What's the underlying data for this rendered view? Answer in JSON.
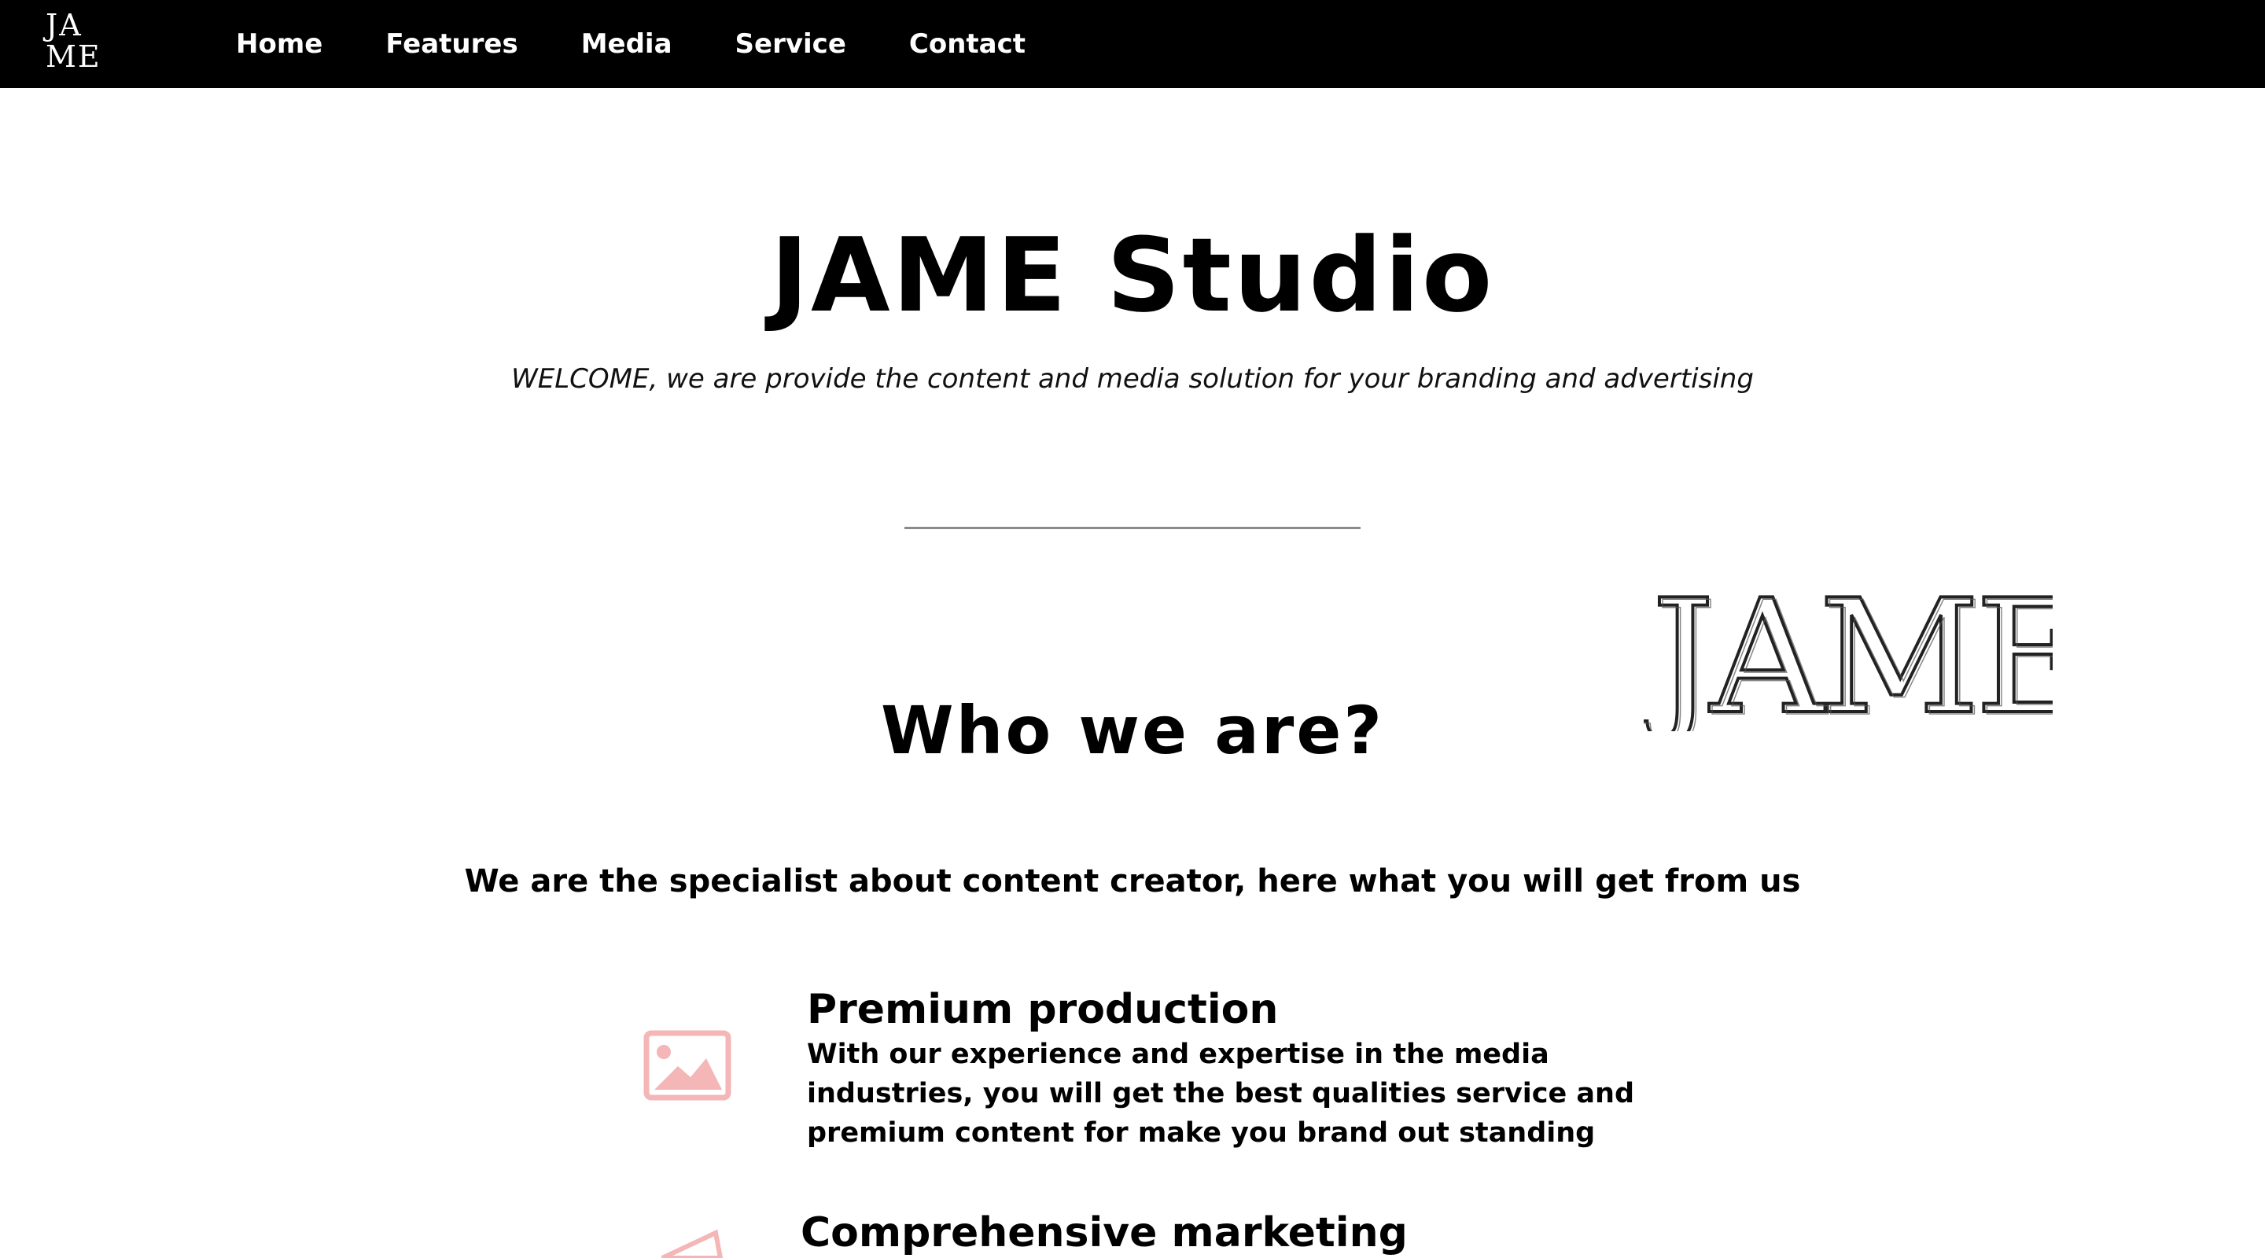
{
  "nav": {
    "logo_line1": "JA",
    "logo_line2": "ME",
    "links": [
      {
        "label": "Home"
      },
      {
        "label": "Features"
      },
      {
        "label": "Media"
      },
      {
        "label": "Service"
      },
      {
        "label": "Contact"
      }
    ]
  },
  "hero": {
    "title": "JAME Studio",
    "subtitle": "WELCOME, we are provide the content and media solution for your branding and advertising"
  },
  "brand_sketch": {
    "text": "JAME"
  },
  "who": {
    "title": "Who we are?",
    "intro": "We are the specialist about content creator, here what you will get from us"
  },
  "features": [
    {
      "title": "Premium production",
      "text": "With our experience and expertise in the media industries, you will get the best qualities service and premium content for make you brand out standing",
      "icon": "image-icon"
    },
    {
      "title": "Comprehensive marketing",
      "text": "",
      "icon": "megaphone-icon"
    }
  ],
  "colors": {
    "nav_bg": "#000000",
    "accent_pink": "#f4b6b6",
    "divider": "#8a8a8a"
  }
}
